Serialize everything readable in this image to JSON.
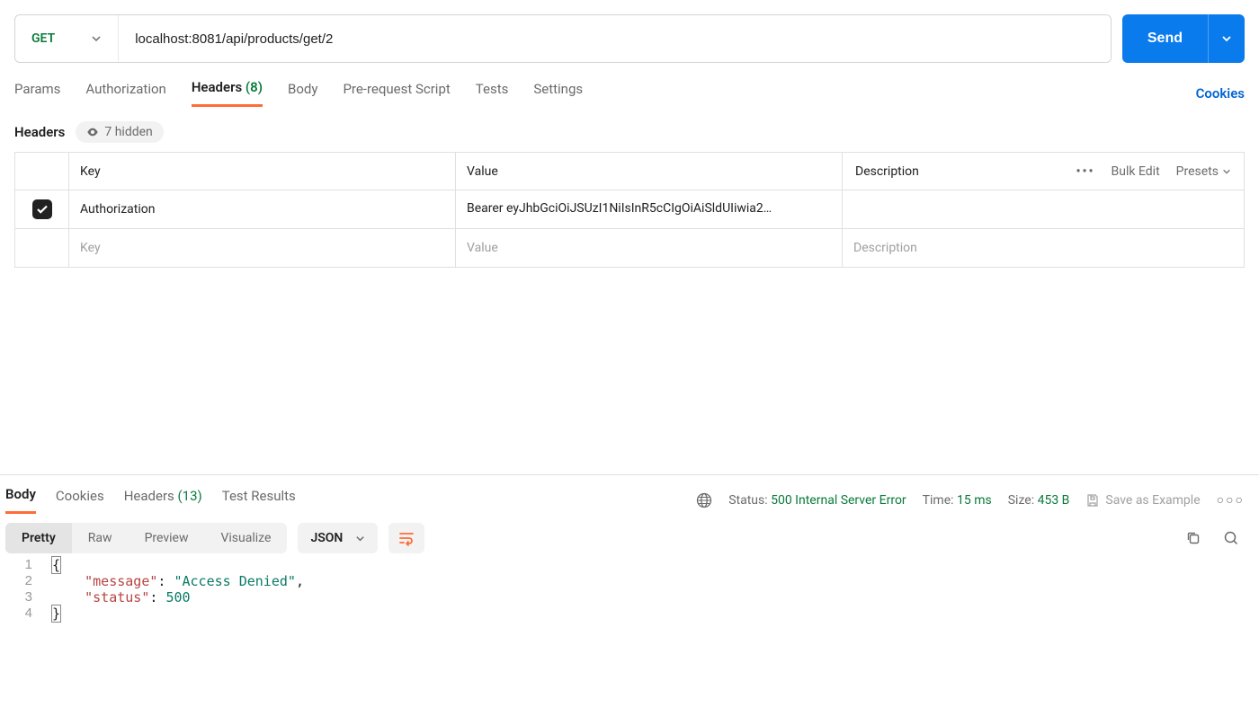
{
  "request": {
    "method": "GET",
    "url": "localhost:8081/api/products/get/2",
    "send_label": "Send"
  },
  "tabs": {
    "items": [
      {
        "label": "Params"
      },
      {
        "label": "Authorization"
      },
      {
        "label": "Headers",
        "count": "(8)",
        "active": true
      },
      {
        "label": "Body"
      },
      {
        "label": "Pre-request Script"
      },
      {
        "label": "Tests"
      },
      {
        "label": "Settings"
      }
    ],
    "cookies": "Cookies"
  },
  "headers_section": {
    "title": "Headers",
    "hidden_label": "7 hidden",
    "columns": {
      "key": "Key",
      "value": "Value",
      "description": "Description"
    },
    "bulk_edit": "Bulk Edit",
    "presets": "Presets",
    "rows": [
      {
        "checked": true,
        "key": "Authorization",
        "value": "Bearer eyJhbGciOiJSUzI1NiIsInR5cCIgOiAiSldUIiwia2…"
      }
    ],
    "placeholders": {
      "key": "Key",
      "value": "Value",
      "description": "Description"
    }
  },
  "response": {
    "tabs": [
      {
        "label": "Body",
        "active": true
      },
      {
        "label": "Cookies"
      },
      {
        "label": "Headers",
        "count": "(13)"
      },
      {
        "label": "Test Results"
      }
    ],
    "status_label": "Status:",
    "status_value": "500 Internal Server Error",
    "time_label": "Time:",
    "time_value": "15 ms",
    "size_label": "Size:",
    "size_value": "453 B",
    "save_example": "Save as Example",
    "view_modes": [
      {
        "label": "Pretty",
        "active": true
      },
      {
        "label": "Raw"
      },
      {
        "label": "Preview"
      },
      {
        "label": "Visualize"
      }
    ],
    "format": "JSON",
    "body_json": {
      "message": "Access Denied",
      "status": 500
    }
  }
}
